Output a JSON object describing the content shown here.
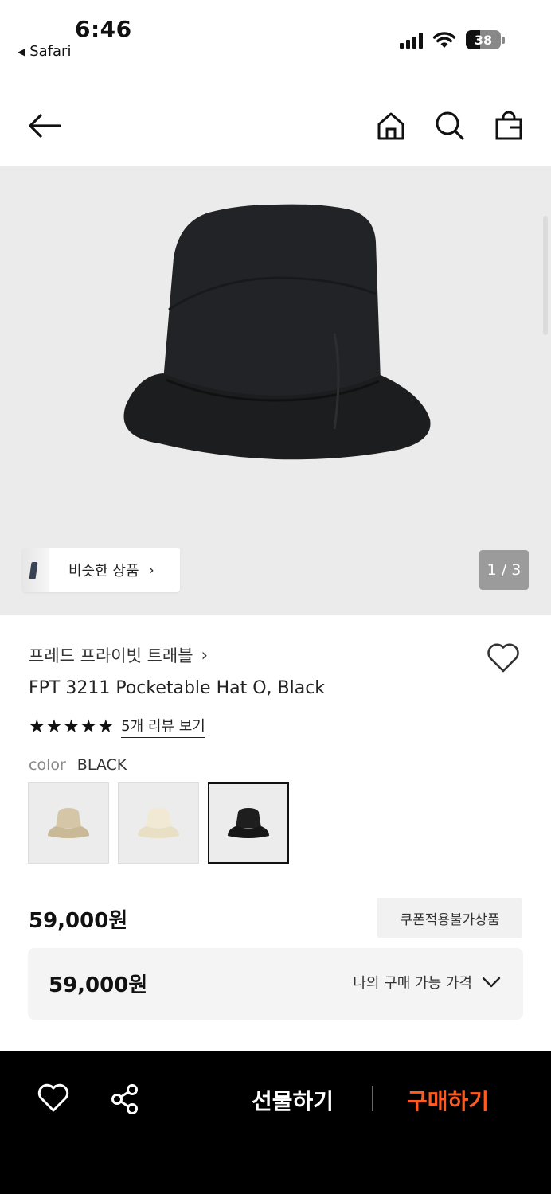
{
  "status_bar": {
    "time": "6:46",
    "back_app": "Safari",
    "battery": "38"
  },
  "nav": {
    "icons": [
      "back-arrow-icon",
      "home-icon",
      "search-icon",
      "shopping-bag-icon"
    ]
  },
  "gallery": {
    "similar_label": "비슷한 상품",
    "page_counter": "1 / 3",
    "background": "#ebebeb"
  },
  "product": {
    "brand": "프레드 프라이빗 트래블",
    "name": "FPT 3211 Pocketable Hat O, Black",
    "rating_stars": 5,
    "review_link": "5개 리뷰 보기",
    "color_label": "color",
    "color_value": "BLACK",
    "swatches": [
      {
        "name": "beige",
        "color": "#d5c6a8"
      },
      {
        "name": "cream",
        "color": "#f1e9d3"
      },
      {
        "name": "black",
        "color": "#1e1e1e",
        "selected": true
      }
    ],
    "price": "59,000원",
    "coupon_badge": "쿠폰적용불가상품",
    "my_price_value": "59,000원",
    "my_price_label": "나의 구매 가능 가격"
  },
  "bottom_bar": {
    "gift_label": "선물하기",
    "buy_label": "구매하기",
    "buy_color": "#ff5a1f"
  }
}
